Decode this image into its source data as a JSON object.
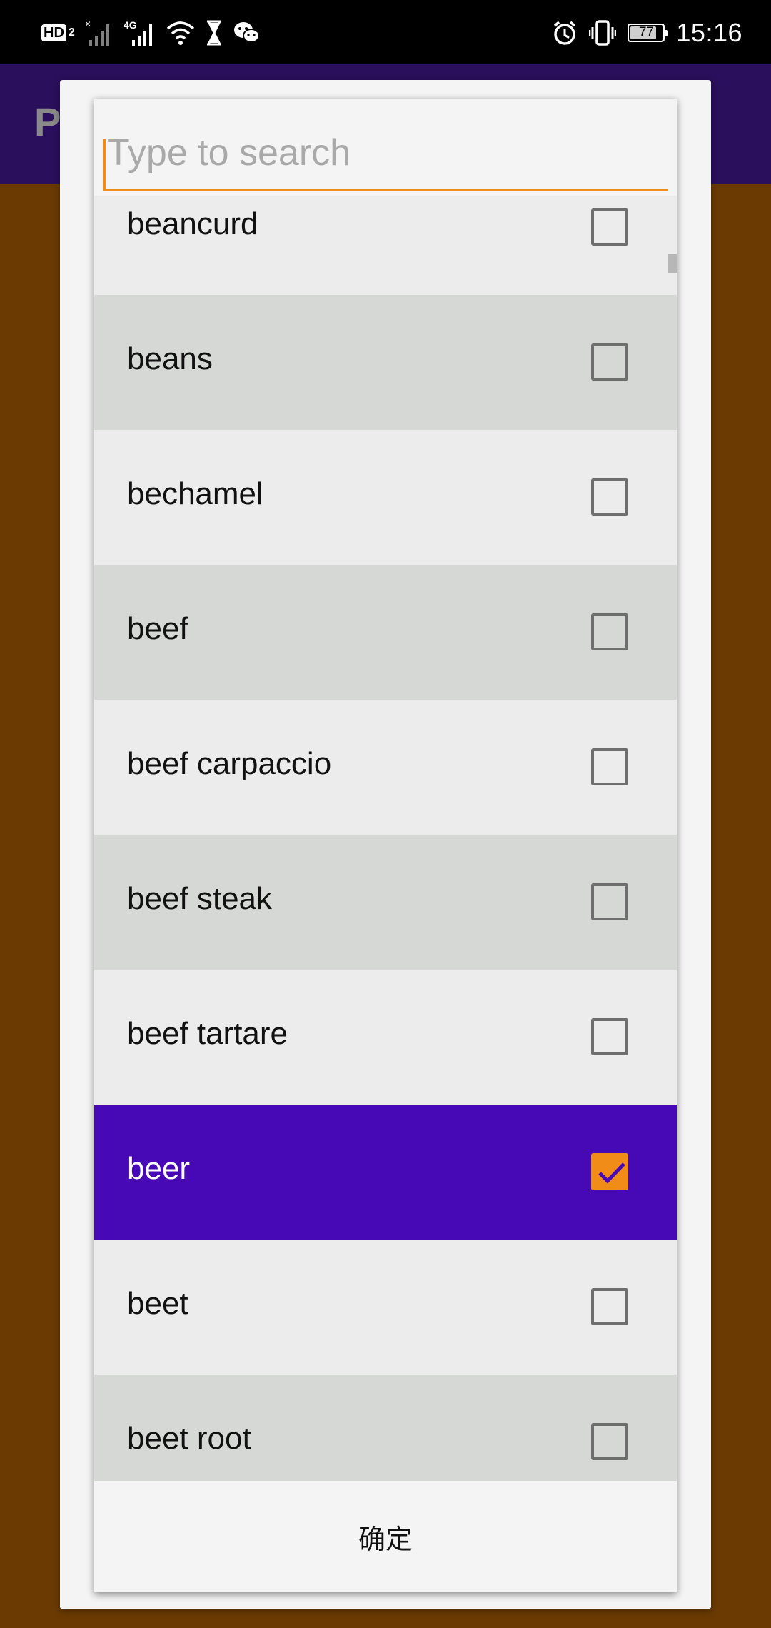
{
  "status_bar": {
    "network_badge": "HD",
    "network_badge_sub": "2",
    "signal_label": "4G",
    "battery_level": "77",
    "time": "15:16",
    "icons": [
      "hd-icon",
      "no-signal-icon",
      "signal-4g-icon",
      "wifi-icon",
      "hourglass-icon",
      "wechat-icon",
      "alarm-icon",
      "vibrate-icon",
      "battery-icon"
    ]
  },
  "app": {
    "title_partial": "P",
    "toolbar_color": "#2a0f5c",
    "background_color": "#6a3a02"
  },
  "dialog": {
    "search": {
      "placeholder": "Type to search",
      "value": ""
    },
    "items": [
      {
        "label": "beancurd",
        "checked": false
      },
      {
        "label": "beans",
        "checked": false
      },
      {
        "label": "bechamel",
        "checked": false
      },
      {
        "label": "beef",
        "checked": false
      },
      {
        "label": "beef carpaccio",
        "checked": false
      },
      {
        "label": "beef steak",
        "checked": false
      },
      {
        "label": "beef tartare",
        "checked": false
      },
      {
        "label": "beer",
        "checked": true
      },
      {
        "label": "beet",
        "checked": false
      },
      {
        "label": "beet root",
        "checked": false
      }
    ],
    "confirm_label": "确定",
    "colors": {
      "accent": "#f28c18",
      "selected_row": "#4708b5",
      "row_light": "#ececec",
      "row_dark": "#d5d8d5"
    }
  }
}
